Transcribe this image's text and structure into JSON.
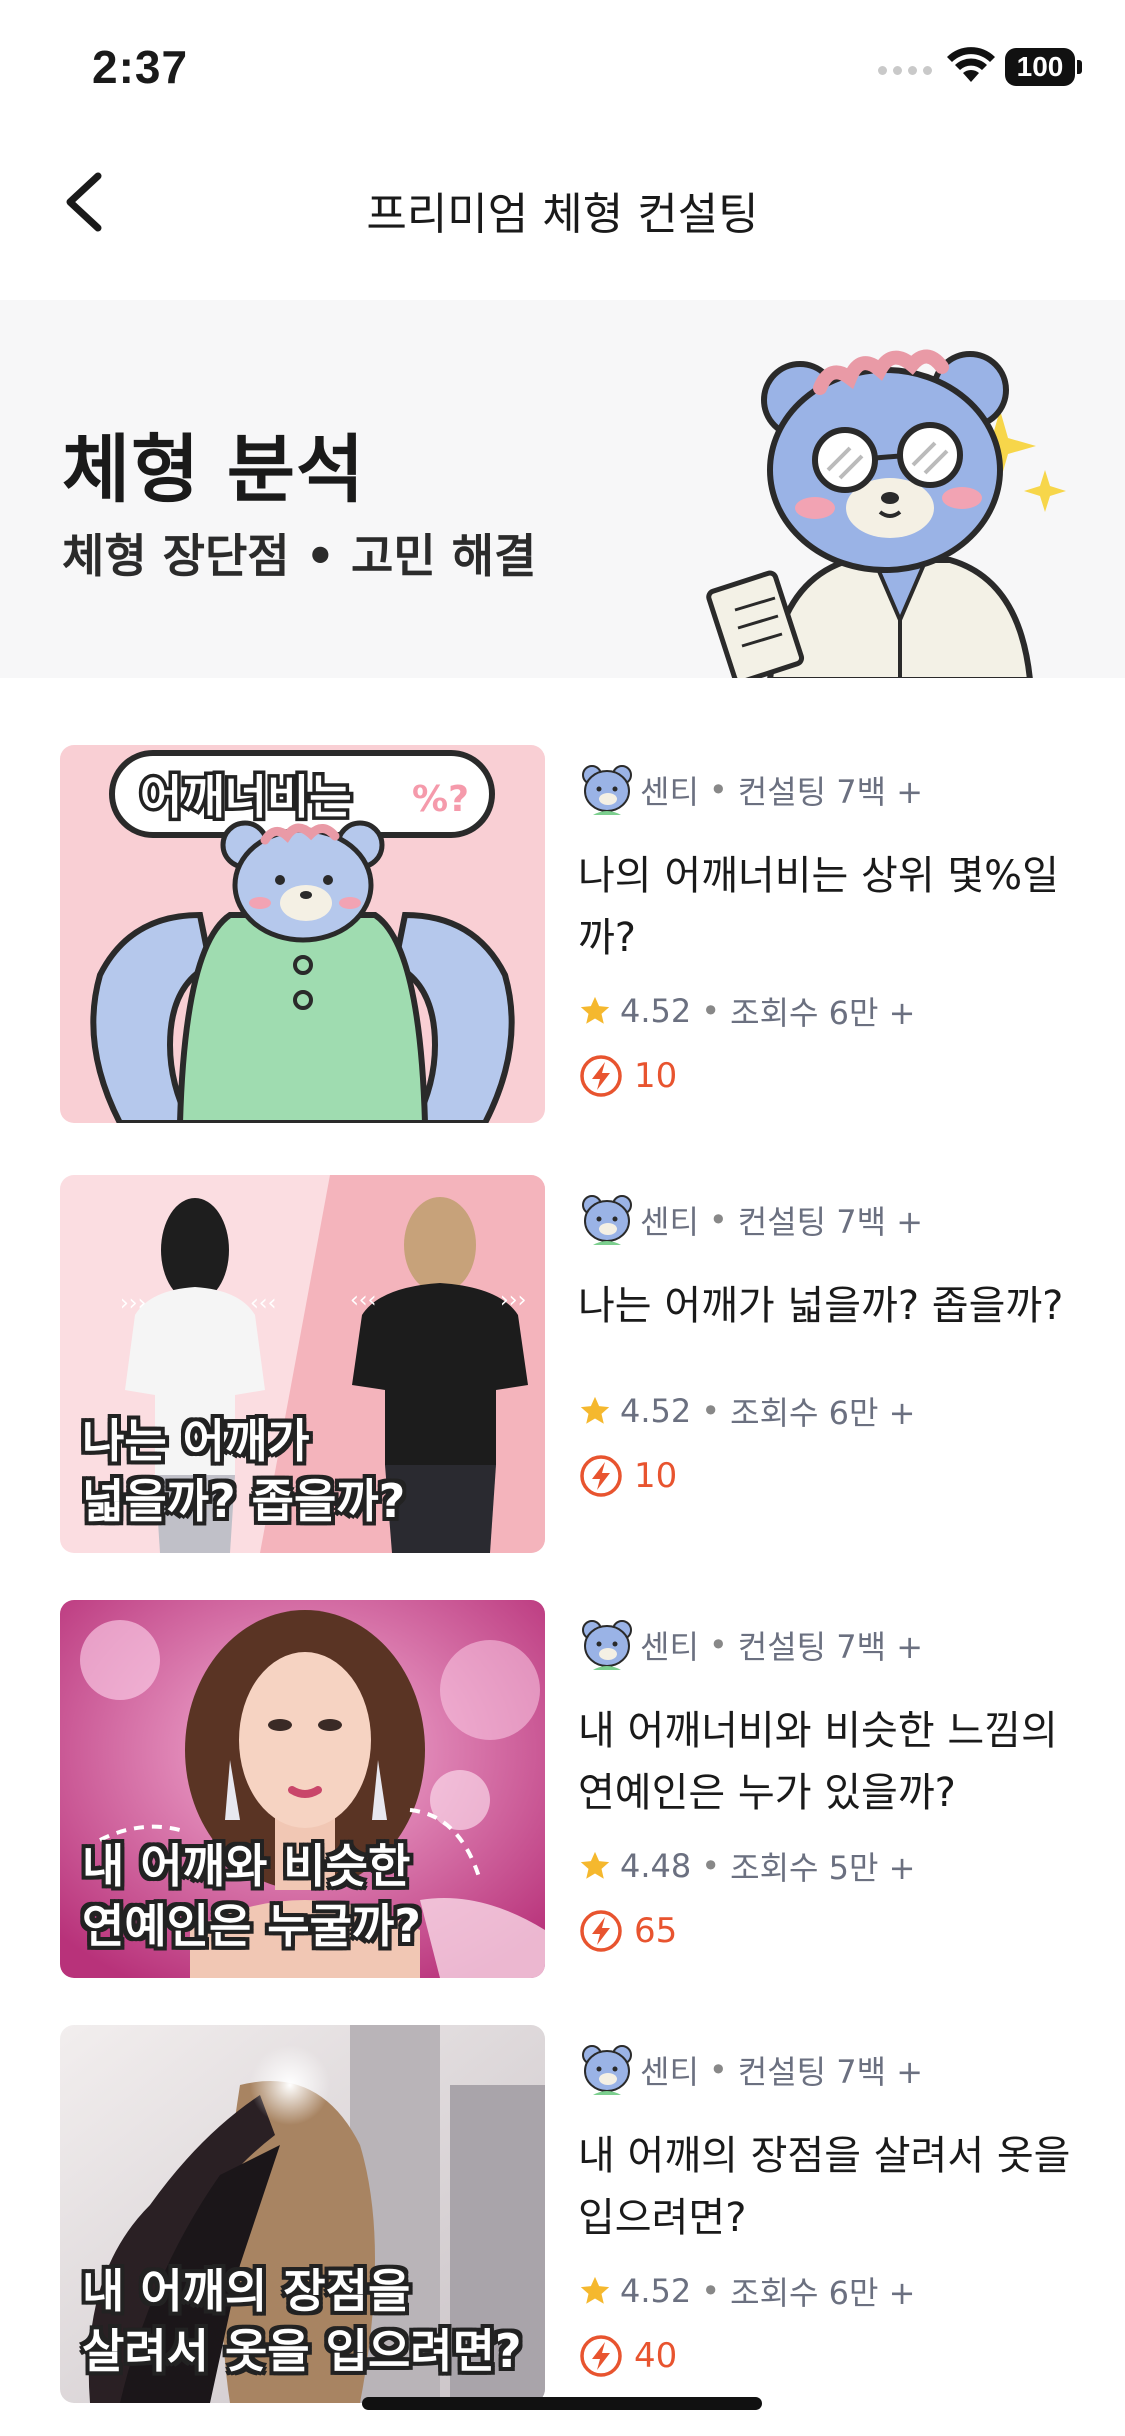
{
  "status": {
    "time": "2:37",
    "battery": "100"
  },
  "nav": {
    "title": "프리미엄 체형 컨설팅",
    "back_icon": "chevron-left-icon"
  },
  "banner": {
    "title": "체형 분석",
    "subtitle": "체형 장단점 • 고민 해결",
    "mascot": "doctor-bear-mascot"
  },
  "cards": [
    {
      "thumb_badge": "어깨너비는",
      "thumb_badge_suffix": "%?",
      "thumb_caption": "",
      "author": "센티",
      "consult_count": "컨설팅 7백 +",
      "title": "나의 어깨너비는 상위 몇%일까?",
      "rating": "4.52",
      "views": "조회수 6만 +",
      "points": "10"
    },
    {
      "thumb_caption": "나는 어깨가\n넓을까? 좁을까?",
      "author": "센티",
      "consult_count": "컨설팅 7백 +",
      "title": "나는 어깨가 넓을까? 좁을까?",
      "rating": "4.52",
      "views": "조회수 6만 +",
      "points": "10"
    },
    {
      "thumb_caption": "내 어깨와 비슷한\n연예인은 누굴까?",
      "author": "센티",
      "consult_count": "컨설팅 7백 +",
      "title": "내 어깨너비와 비슷한 느낌의 연예인은 누가 있을까?",
      "rating": "4.48",
      "views": "조회수 5만 +",
      "points": "65"
    },
    {
      "thumb_caption": "내 어깨의 장점을\n살려서 옷을 입으려면?",
      "author": "센티",
      "consult_count": "컨설팅 7백 +",
      "title": "내 어깨의 장점을 살려서 옷을 입으려면?",
      "rating": "4.52",
      "views": "조회수 6만 +",
      "points": "40"
    }
  ],
  "colors": {
    "accent": "#e8542f",
    "star": "#f5b82e",
    "meta": "#6b7080",
    "banner_bg": "#f7f7f8"
  }
}
